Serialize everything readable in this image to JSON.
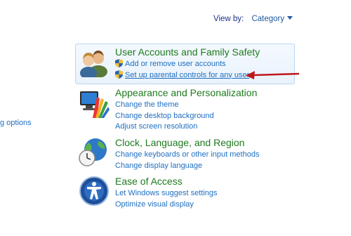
{
  "view_by": {
    "label": "View by:",
    "value": "Category"
  },
  "side_link": "g options",
  "categories": [
    {
      "title": "User Accounts and Family Safety",
      "links": [
        "Add or remove user accounts",
        "Set up parental controls for any user"
      ]
    },
    {
      "title": "Appearance and Personalization",
      "links": [
        "Change the theme",
        "Change desktop background",
        "Adjust screen resolution"
      ]
    },
    {
      "title": "Clock, Language, and Region",
      "links": [
        "Change keyboards or other input methods",
        "Change display language"
      ]
    },
    {
      "title": "Ease of Access",
      "links": [
        "Let Windows suggest settings",
        "Optimize visual display"
      ]
    }
  ],
  "colors": {
    "title_green": "#1e7a1e",
    "link_blue": "#1f6fc0",
    "arrow_red": "#c0161b",
    "highlight_border": "#b9d7f2"
  }
}
